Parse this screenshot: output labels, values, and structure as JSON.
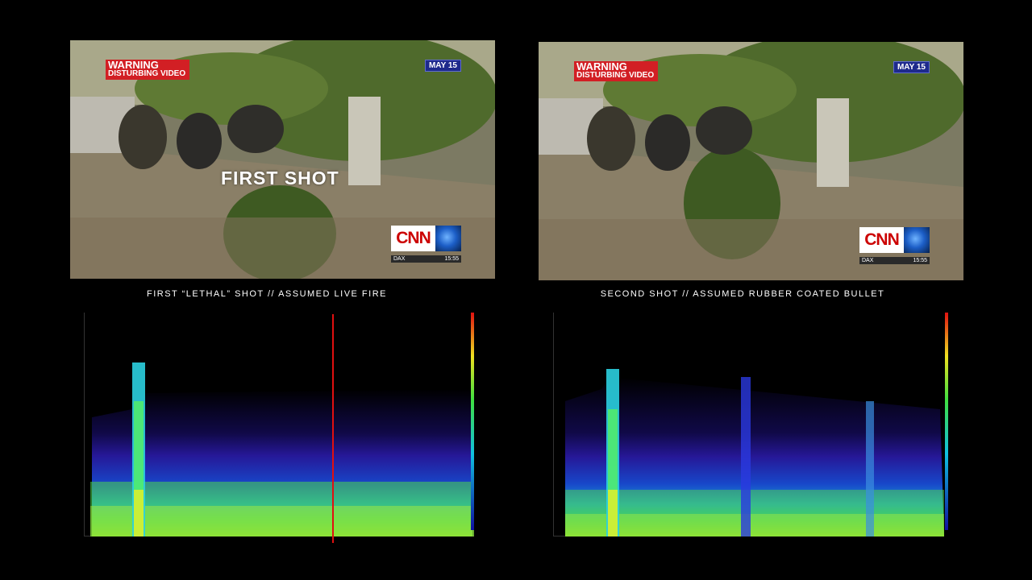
{
  "left": {
    "warning_line1": "WARNING",
    "warning_line2": "DISTURBING VIDEO",
    "date": "MAY 15",
    "overlay": "FIRST SHOT",
    "logo": "CNN",
    "ticker_label": "DAX",
    "ticker_time": "15:55",
    "caption": "FIRST “LETHAL” SHOT // ASSUMED LIVE FIRE"
  },
  "right": {
    "warning_line1": "WARNING",
    "warning_line2": "DISTURBING VIDEO",
    "date": "MAY 15",
    "logo": "CNN",
    "ticker_label": "DAX",
    "ticker_time": "15:55",
    "caption": "SECOND SHOT // ASSUMED RUBBER COATED BULLET"
  },
  "colors": {
    "background": "#000000",
    "warning_red": "#d21f24",
    "date_blue": "#1e2a8c",
    "cursor_red": "#e01010"
  }
}
